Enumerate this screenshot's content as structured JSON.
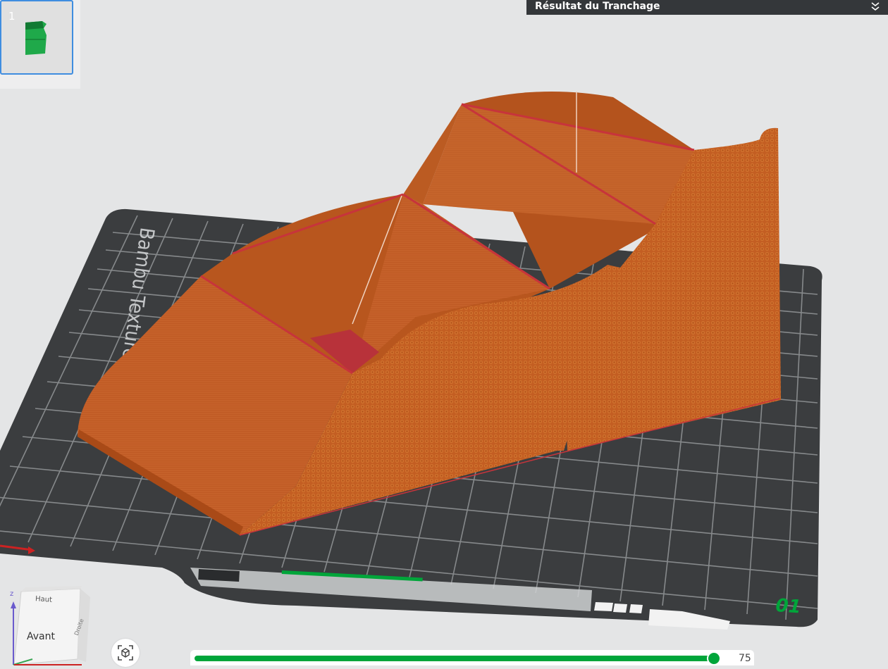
{
  "plate": {
    "side_text": "Bambu Textured PEI Plate",
    "number": "01"
  },
  "thumbnails": [
    {
      "index": "1",
      "selected": true
    }
  ],
  "result_panel": {
    "title": "Résultat du Tranchage",
    "collapse_icon": "double-chevron-down-icon"
  },
  "view_cube": {
    "top_face": "Haut",
    "front_face": "Avant",
    "side_face": "Droite",
    "axis_label": "z"
  },
  "reset_view": {
    "icon": "cube-focus-icon"
  },
  "layer_slider": {
    "value": "75",
    "fraction": 0.97
  },
  "colors": {
    "model": "#c35e22",
    "model_seam": "#c7343b",
    "plate": "#3b3d3f",
    "accent": "#00a53a"
  }
}
